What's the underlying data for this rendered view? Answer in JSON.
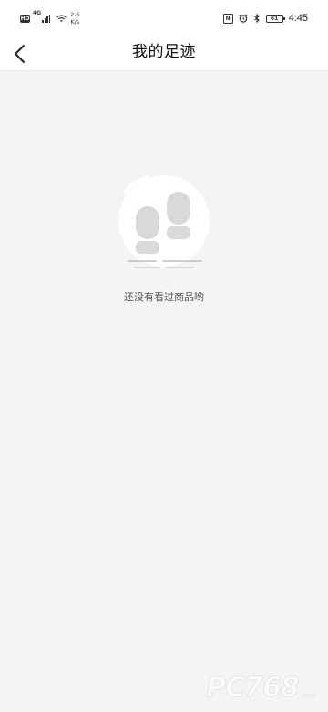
{
  "status_bar": {
    "hd_badge": "HD",
    "network_type": "4G",
    "speed_value": "2.6",
    "speed_unit": "K/s",
    "nfc_label": "N",
    "battery_level": "61",
    "time": "4:45",
    "icons": [
      "hd-icon",
      "signal-icon",
      "wifi-icon",
      "nfc-icon",
      "alarm-icon",
      "bluetooth-icon",
      "battery-icon"
    ]
  },
  "nav": {
    "back_icon": "chevron-left-icon",
    "title": "我的足迹"
  },
  "empty_state": {
    "illustration_icon": "footprints-icon",
    "message": "还没有看过商品哟"
  },
  "watermark": {
    "text": "PC768",
    "sub": ".com"
  },
  "colors": {
    "background": "#f4f4f4",
    "bar_background": "#ffffff",
    "title_text": "#111111",
    "message_text": "#555555",
    "illustration_circle": "#ffffff",
    "footprint_fill": "#d9d9d9"
  }
}
